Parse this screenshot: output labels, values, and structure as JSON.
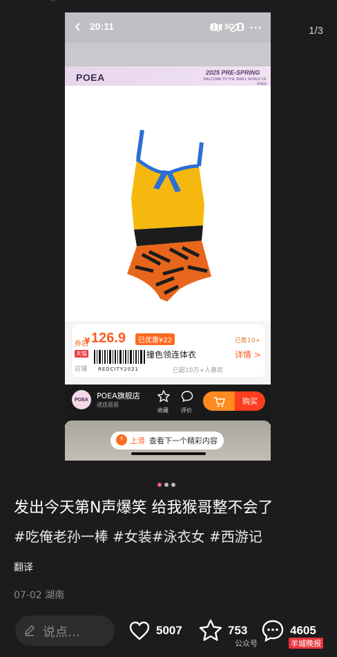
{
  "page_counter": "1/3",
  "phone": {
    "status_time": "20:11",
    "status_network": "5G",
    "banner": {
      "brand": "POEA",
      "title": "2025 PRE-SPRING",
      "subtitle": "WELCOME TO THE SMALL WORLD OF POEA"
    },
    "product": {
      "price_label": "券后",
      "currency": "¥",
      "price": "126.9",
      "coupon": "已优惠¥22",
      "sold": "已售10+",
      "tmall_tag": "天猫",
      "barcode_text": "REDCITY2021",
      "name": "撞色领连体衣",
      "details_label": "详情 >",
      "store_label": "店铺",
      "fav_text": "已超10万+人喜欢"
    },
    "shop": {
      "avatar_text": "POEA",
      "name": "POEA旗舰店",
      "enter": "进店逛逛",
      "fav_label": "收藏",
      "comment_label": "评价",
      "buy_label": "购买"
    },
    "swipe": {
      "up": "上滑",
      "text": "查看下一个精彩内容"
    }
  },
  "post": {
    "title": "发出今天第N声爆笑 给我猴哥整不会了",
    "hashtags": "#吃俺老孙一棒 #女装#泳衣女 #西游记",
    "translate": "翻译",
    "meta": "07-02 湖南"
  },
  "actions": {
    "comment_placeholder": "说点…",
    "likes": "5007",
    "stars": "753",
    "comments": "4605",
    "watermark": "公众号",
    "watermark_badge": "羊城晚报"
  },
  "colors": {
    "accent_orange": "#ff5a1f",
    "active_dot": "#f25c8a"
  }
}
